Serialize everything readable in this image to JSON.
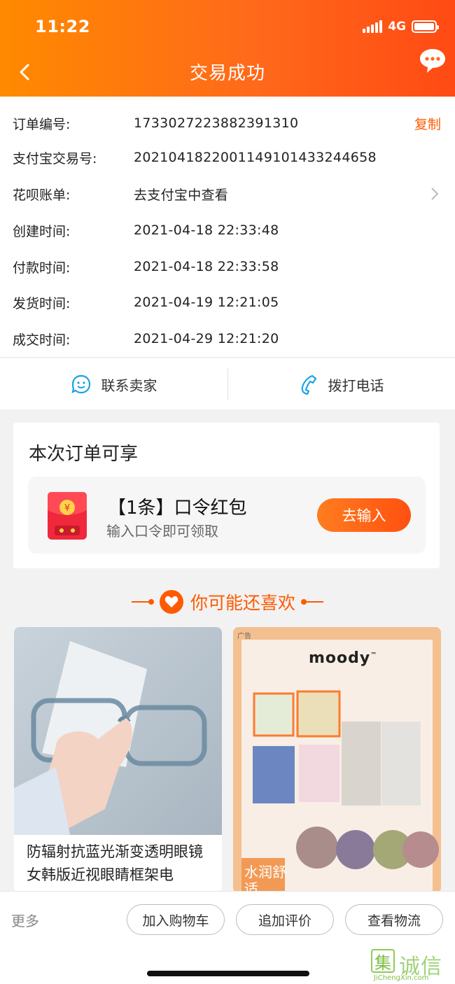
{
  "status_bar": {
    "time": "11:22",
    "network": "4G"
  },
  "header": {
    "title": "交易成功"
  },
  "order_info": [
    {
      "label": "订单编号:",
      "value": "1733027223882391310",
      "action": "复制"
    },
    {
      "label": "支付宝交易号:",
      "value": "2021041822001149101433244658"
    },
    {
      "label": "花呗账单:",
      "value": "去支付宝中查看",
      "link": true
    },
    {
      "label": "创建时间:",
      "value": "2021-04-18 22:33:48"
    },
    {
      "label": "付款时间:",
      "value": "2021-04-18 22:33:58"
    },
    {
      "label": "发货时间:",
      "value": "2021-04-19 12:21:05"
    },
    {
      "label": "成交时间:",
      "value": "2021-04-29 12:21:20"
    }
  ],
  "contact": {
    "seller": "联系卖家",
    "phone": "拨打电话"
  },
  "coupon": {
    "heading": "本次订单可享",
    "title": "【1条】口令红包",
    "subtitle": "输入口令即可领取",
    "button": "去输入"
  },
  "recommend": {
    "heading": "你可能还喜欢"
  },
  "products": [
    {
      "title": "防辐射抗蓝光渐变透明眼镜女韩版近视眼睛框架电"
    },
    {
      "ad_label": "广告",
      "brand": "moody",
      "tm": "™",
      "slogan": "水润舒适"
    }
  ],
  "bottom_bar": {
    "more": "更多",
    "buttons": [
      "加入购物车",
      "追加评价",
      "查看物流"
    ]
  },
  "watermark": {
    "name": "诚信",
    "url": "JiChengXin.com"
  },
  "colors": {
    "accent": "#ff5a00",
    "header_start": "#ff8a00",
    "header_end": "#ff4a14"
  }
}
